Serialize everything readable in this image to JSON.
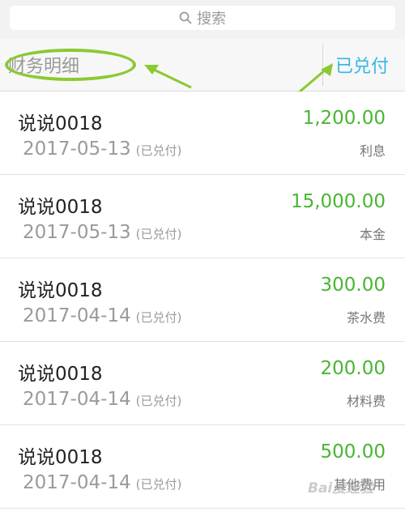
{
  "search": {
    "placeholder": "搜索"
  },
  "header": {
    "title": "财务明细",
    "tab": "已兑付"
  },
  "records": [
    {
      "name": "说说0018",
      "date": "2017-05-13",
      "status": "(已兑付)",
      "amount": "1,200.00",
      "category": "利息"
    },
    {
      "name": "说说0018",
      "date": "2017-05-13",
      "status": "(已兑付)",
      "amount": "15,000.00",
      "category": "本金"
    },
    {
      "name": "说说0018",
      "date": "2017-04-14",
      "status": "(已兑付)",
      "amount": "300.00",
      "category": "茶水费"
    },
    {
      "name": "说说0018",
      "date": "2017-04-14",
      "status": "(已兑付)",
      "amount": "200.00",
      "category": "材料费"
    },
    {
      "name": "说说0018",
      "date": "2017-04-14",
      "status": "(已兑付)",
      "amount": "500.00",
      "category": "其他费用"
    }
  ],
  "watermark": "Bai度经验",
  "colors": {
    "amount": "#49b532",
    "tab": "#33b6e8",
    "annotation": "#8bc932"
  }
}
